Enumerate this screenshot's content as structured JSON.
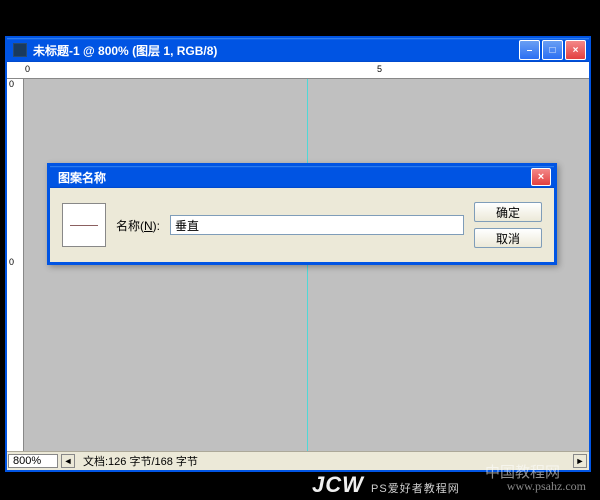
{
  "window": {
    "title": "未标题-1 @ 800% (图层 1, RGB/8)"
  },
  "ruler": {
    "h0": "0",
    "h5": "5",
    "v0a": "0",
    "v0b": "0"
  },
  "statusbar": {
    "zoom": "800%",
    "doc_info": "文档:126 字节/168 字节",
    "arrow_left": "◄",
    "arrow_right": "►"
  },
  "dialog": {
    "title": "图案名称",
    "name_label_pre": "名称(",
    "name_label_hotkey": "N",
    "name_label_post": "):",
    "name_value": "垂直",
    "ok": "确定",
    "cancel": "取消",
    "close_x": "×"
  },
  "win_buttons": {
    "min": "–",
    "max": "□",
    "close": "×"
  },
  "watermarks": {
    "w1": "www.psahz.com",
    "w2": "中国教程网",
    "w3_a": "JCW",
    "w3_b": "PS爱好者教程网"
  }
}
